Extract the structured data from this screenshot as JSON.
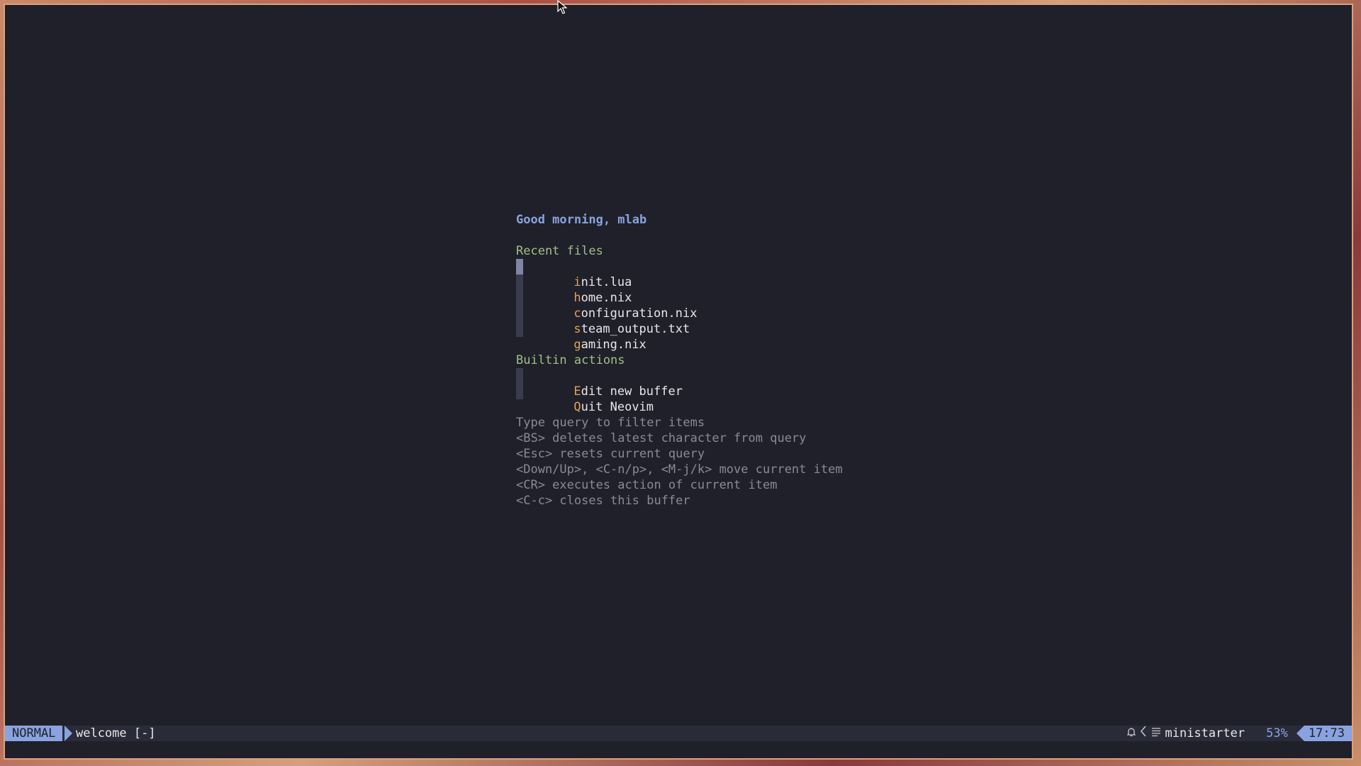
{
  "starter": {
    "greeting": "Good morning, mlab",
    "recent_title": "Recent files",
    "recent_files": [
      {
        "hl": "i",
        "rest": "nit.lua"
      },
      {
        "hl": "h",
        "rest": "ome.nix"
      },
      {
        "hl": "c",
        "rest": "onfiguration.nix"
      },
      {
        "hl": "s",
        "rest": "team_output.txt"
      },
      {
        "hl": "g",
        "rest": "aming.nix"
      }
    ],
    "builtin_title": "Builtin actions",
    "builtin_actions": [
      {
        "hl": "E",
        "rest": "dit new buffer"
      },
      {
        "hl": "Q",
        "rest": "uit Neovim"
      }
    ],
    "help": [
      "Type query to filter items",
      "<BS> deletes latest character from query",
      "<Esc> resets current query",
      "<Down/Up>, <C-n/p>, <M-j/k> move current item",
      "<CR> executes action of current item",
      "<C-c> closes this buffer"
    ]
  },
  "statusline": {
    "mode": "NORMAL",
    "filename": "welcome [-]",
    "filetype_icon": "bell-icon",
    "separator_icon": "chevron-left-icon",
    "list_icon": "list-icon",
    "filetype": "ministarter",
    "percent": "53%",
    "position": "17:73"
  },
  "colors": {
    "background": "#1f2029",
    "accent": "#8aa2e0",
    "section": "#a3be8c",
    "highlight": "#e0a060",
    "help": "#8a8a94"
  }
}
